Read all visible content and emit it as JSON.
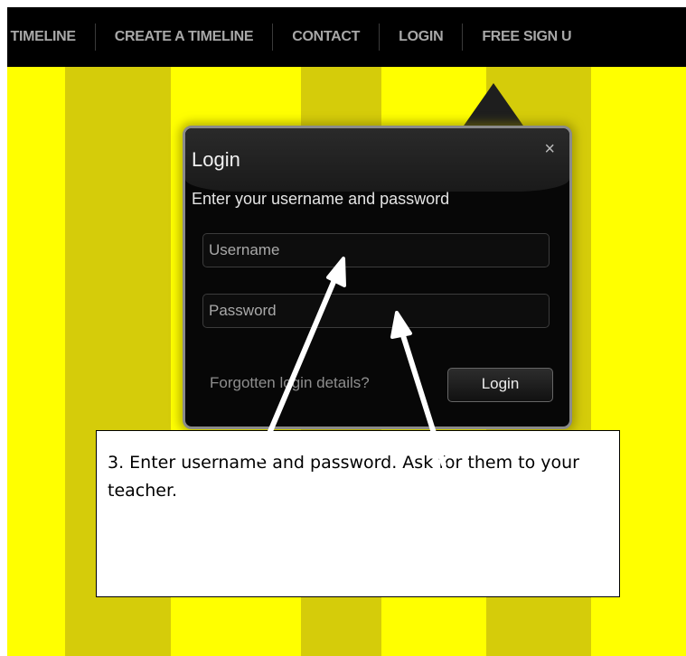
{
  "nav": {
    "items": [
      {
        "label": "S TIMELINE"
      },
      {
        "label": "CREATE A TIMELINE"
      },
      {
        "label": "CONTACT"
      },
      {
        "label": "LOGIN"
      },
      {
        "label": "FREE SIGN U"
      }
    ]
  },
  "login_popup": {
    "title": "Login",
    "close_label": "×",
    "instructions": "Enter your username and password",
    "username_placeholder": "Username",
    "password_placeholder": "Password",
    "forgot_link": "Forgotten login details?",
    "login_button": "Login"
  },
  "callout": {
    "text": "3. Enter username and password. Ask for them to your teacher."
  },
  "colors": {
    "background": "#ffff00",
    "stripe": "#d5cc0a",
    "navbar": "#000000",
    "popup": "#070707",
    "arrow": "#ffffff"
  }
}
